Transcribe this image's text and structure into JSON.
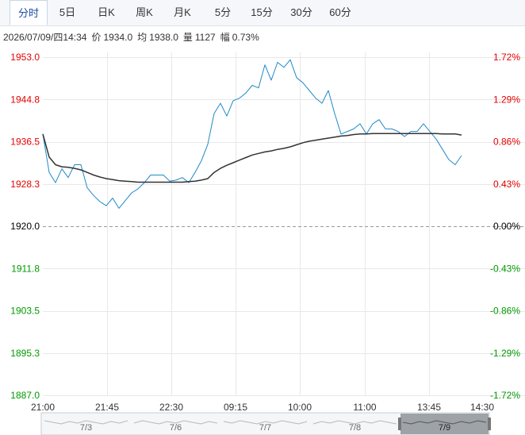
{
  "tabs": [
    "分时",
    "5日",
    "日K",
    "周K",
    "月K",
    "5分",
    "15分",
    "30分",
    "60分"
  ],
  "active_tab": 0,
  "info": {
    "datetime": "2026/07/09/四14:34",
    "price_label": "价",
    "price": "1934.0",
    "avg_label": "均",
    "avg": "1938.0",
    "volume_label": "量",
    "volume": "1127",
    "change_label": "幅",
    "change": "0.73%"
  },
  "colors": {
    "up": "#e60000",
    "down": "#009900",
    "neutral": "#000000",
    "price_line": "#1f8ac8",
    "avg_line": "#333333",
    "grid": "#e8e8e8",
    "ref_line": "#999999"
  },
  "chart_data": {
    "type": "line",
    "y_left_ticks": [
      "1953.0",
      "1944.8",
      "1936.5",
      "1928.3",
      "1920.0",
      "1911.8",
      "1903.5",
      "1895.3",
      "1887.0"
    ],
    "y_right_ticks": [
      "1.72%",
      "1.29%",
      "0.86%",
      "0.43%",
      "0.00%",
      "-0.43%",
      "-0.86%",
      "-1.29%",
      "-1.72%"
    ],
    "ylim": [
      1887.0,
      1953.0
    ],
    "reference_price": 1920.0,
    "x_ticks": [
      "21:00",
      "21:45",
      "22:30",
      "09:15",
      "10:00",
      "11:00",
      "13:45",
      "14:30"
    ],
    "session_dividers": [
      1,
      2,
      3,
      4,
      5,
      6
    ],
    "grid": true,
    "series": [
      {
        "key": "price",
        "x": [
          0,
          1,
          2,
          3,
          4,
          5,
          6,
          7,
          8,
          9,
          10,
          11,
          12,
          13,
          14,
          15,
          16,
          17,
          18,
          19,
          20,
          21,
          22,
          23,
          24,
          25,
          26,
          27,
          28,
          29,
          30,
          31,
          32,
          33,
          34,
          35,
          36,
          37,
          38,
          39,
          40,
          41,
          42,
          43,
          44,
          45,
          46,
          47,
          48,
          49,
          50,
          51,
          52,
          53,
          54,
          55,
          56,
          57,
          58,
          59,
          60,
          61,
          62,
          63,
          64,
          65,
          66
        ],
        "values": [
          1938.0,
          1930.5,
          1928.5,
          1931.2,
          1929.5,
          1932.0,
          1932.0,
          1927.5,
          1926.0,
          1924.8,
          1924.0,
          1925.5,
          1923.5,
          1925.0,
          1926.5,
          1927.3,
          1928.5,
          1930.0,
          1930.0,
          1930.0,
          1928.8,
          1929.0,
          1929.5,
          1928.5,
          1930.5,
          1932.8,
          1936.0,
          1942.0,
          1944.0,
          1941.5,
          1944.5,
          1945.0,
          1946.0,
          1947.5,
          1947.0,
          1951.5,
          1948.5,
          1952.0,
          1951.0,
          1952.5,
          1949.0,
          1948.0,
          1946.5,
          1945.0,
          1944.0,
          1946.5,
          1942.0,
          1938.0,
          1938.5,
          1939.0,
          1940.0,
          1938.0,
          1940.0,
          1940.8,
          1939.0,
          1939.0,
          1938.5,
          1937.5,
          1938.5,
          1938.5,
          1940.0,
          1938.5,
          1937.0,
          1935.0,
          1933.0,
          1932.0,
          1933.8
        ]
      },
      {
        "key": "avg",
        "x": [
          0,
          1,
          2,
          3,
          4,
          5,
          6,
          7,
          8,
          9,
          10,
          11,
          12,
          13,
          14,
          15,
          16,
          17,
          18,
          19,
          20,
          21,
          22,
          23,
          24,
          25,
          26,
          27,
          28,
          29,
          30,
          31,
          32,
          33,
          34,
          35,
          36,
          37,
          38,
          39,
          40,
          41,
          42,
          43,
          44,
          45,
          46,
          47,
          48,
          49,
          50,
          51,
          52,
          53,
          54,
          55,
          56,
          57,
          58,
          59,
          60,
          61,
          62,
          63,
          64,
          65,
          66
        ],
        "values": [
          1938.0,
          1933.5,
          1932.0,
          1931.6,
          1931.5,
          1931.3,
          1931.0,
          1930.5,
          1930.0,
          1929.6,
          1929.3,
          1929.1,
          1928.9,
          1928.8,
          1928.7,
          1928.6,
          1928.6,
          1928.6,
          1928.6,
          1928.6,
          1928.6,
          1928.6,
          1928.6,
          1928.7,
          1928.8,
          1929.0,
          1929.3,
          1930.5,
          1931.3,
          1931.9,
          1932.4,
          1932.9,
          1933.4,
          1933.9,
          1934.2,
          1934.5,
          1934.7,
          1935.0,
          1935.2,
          1935.5,
          1935.9,
          1936.3,
          1936.6,
          1936.8,
          1937.0,
          1937.2,
          1937.4,
          1937.6,
          1937.7,
          1937.9,
          1938.0,
          1938.0,
          1938.1,
          1938.1,
          1938.1,
          1938.1,
          1938.1,
          1938.1,
          1938.1,
          1938.1,
          1938.1,
          1938.1,
          1938.1,
          1938.0,
          1938.0,
          1938.0,
          1937.8
        ]
      }
    ]
  },
  "navigator": {
    "dates": [
      "7/3",
      "7/6",
      "7/7",
      "7/8",
      "7/9"
    ],
    "selected": 4
  }
}
